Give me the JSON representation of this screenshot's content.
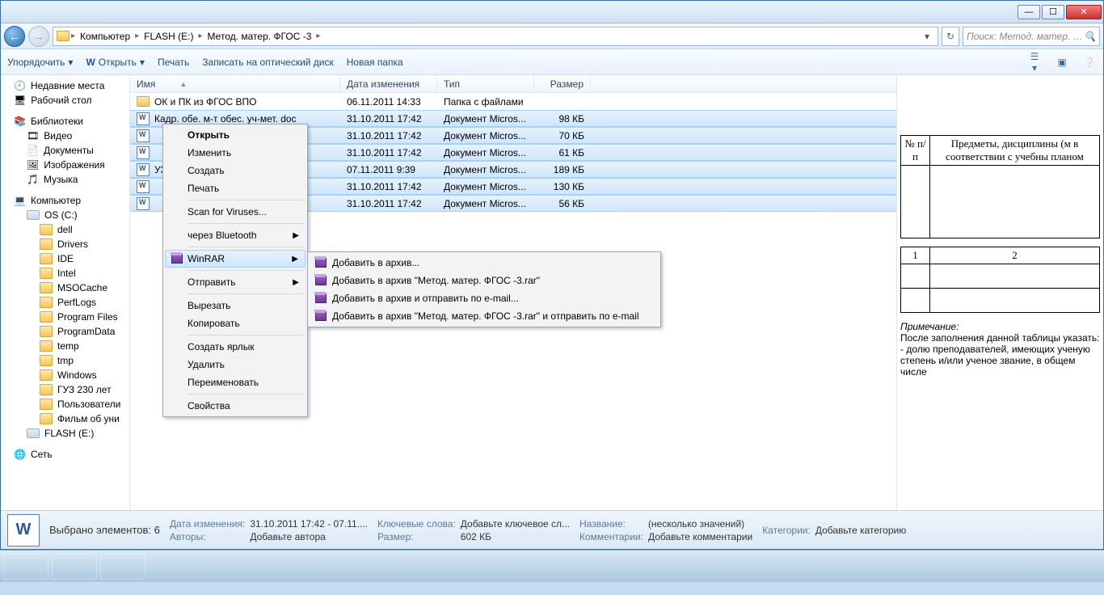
{
  "titlebar": {
    "min": "—",
    "max": "☐",
    "close": "✕"
  },
  "nav": {
    "back": "←",
    "fwd": "→"
  },
  "breadcrumbs": [
    "Компьютер",
    "FLASH (E:)",
    "Метод. матер. ФГОС -3"
  ],
  "search_placeholder": "Поиск: Метод. матер. …",
  "toolbar": {
    "organize": "Упорядочить",
    "open": "Открыть",
    "print": "Печать",
    "burn": "Записать на оптический диск",
    "newfolder": "Новая папка"
  },
  "columns": {
    "name": "Имя",
    "date": "Дата изменения",
    "type": "Тип",
    "size": "Размер"
  },
  "rows": [
    {
      "icon": "folder",
      "name": "ОК и ПК из ФГОС ВПО",
      "date": "06.11.2011 14:33",
      "type": "Папка с файлами",
      "size": "",
      "sel": false
    },
    {
      "icon": "doc",
      "name": "Кадр. обе.  м-т обес.  уч-мет. doc",
      "date": "31.10.2011 17:42",
      "type": "Документ Micros...",
      "size": "98 КБ",
      "sel": true
    },
    {
      "icon": "doc",
      "name": "",
      "date": "31.10.2011 17:42",
      "type": "Документ Micros...",
      "size": "70 КБ",
      "sel": true
    },
    {
      "icon": "doc",
      "name": "",
      "date": "31.10.2011 17:42",
      "type": "Документ Micros...",
      "size": "61 КБ",
      "sel": true
    },
    {
      "icon": "doc",
      "name": "УЗР.d...",
      "date": "07.11.2011 9:39",
      "type": "Документ Micros...",
      "size": "189 КБ",
      "sel": true
    },
    {
      "icon": "doc",
      "name": "",
      "date": "31.10.2011 17:42",
      "type": "Документ Micros...",
      "size": "130 КБ",
      "sel": true
    },
    {
      "icon": "doc",
      "name": "",
      "date": "31.10.2011 17:42",
      "type": "Документ Micros...",
      "size": "56 КБ",
      "sel": true
    }
  ],
  "tree": {
    "recent": "Недавние места",
    "desktop": "Рабочий стол",
    "libraries": "Библиотеки",
    "video": "Видео",
    "documents": "Документы",
    "pictures": "Изображения",
    "music": "Музыка",
    "computer": "Компьютер",
    "osc": "OS (C:)",
    "dell": "dell",
    "drivers": "Drivers",
    "ide": "IDE",
    "intel": "Intel",
    "msocache": "MSOCache",
    "perflogs": "PerfLogs",
    "programfiles": "Program Files",
    "programdata": "ProgramData",
    "temp": "temp",
    "tmp": "tmp",
    "windows": "Windows",
    "guz": "ГУЗ 230 лет",
    "users": "Пользователи",
    "film": "Фильм об уни",
    "flash": "FLASH (E:)",
    "network": "Сеть"
  },
  "ctx1": {
    "open": "Открыть",
    "edit": "Изменить",
    "create": "Создать",
    "print": "Печать",
    "scan": "Scan for Viruses...",
    "bt": "через Bluetooth",
    "winrar": "WinRAR",
    "send": "Отправить",
    "cut": "Вырезать",
    "copy": "Копировать",
    "shortcut": "Создать ярлык",
    "delete": "Удалить",
    "rename": "Переименовать",
    "props": "Свойства"
  },
  "ctx2": {
    "add": "Добавить в архив...",
    "addnamed": "Добавить в архив \"Метод. матер. ФГОС -3.rar\"",
    "addemail": "Добавить в архив и отправить по e-mail...",
    "addnamedemail": "Добавить в архив \"Метод. матер. ФГОС -3.rar\" и отправить по e-mail"
  },
  "preview": {
    "hdr_num": "№ п/п",
    "hdr_subj": "Предметы, дисциплины (м в соответствии с учебны планом",
    "c1": "1",
    "c2": "2",
    "note_title": "Примечание:",
    "note_body": "После заполнения данной таблицы указать:\n- долю преподавателей, имеющих ученую степень и/или ученое звание, в общем числе"
  },
  "status": {
    "selected": "Выбрано элементов: 6",
    "date_lbl": "Дата изменения:",
    "date_val": "31.10.2011 17:42 - 07.11....",
    "auth_lbl": "Авторы:",
    "auth_val": "Добавьте автора",
    "kw_lbl": "Ключевые слова:",
    "kw_val": "Добавьте ключевое сл...",
    "size_lbl": "Размер:",
    "size_val": "602 КБ",
    "title_lbl": "Название:",
    "title_val": "(несколько значений)",
    "comm_lbl": "Комментарии:",
    "comm_val": "Добавьте комментарии",
    "cat_lbl": "Категории:",
    "cat_val": "Добавьте категорию"
  }
}
